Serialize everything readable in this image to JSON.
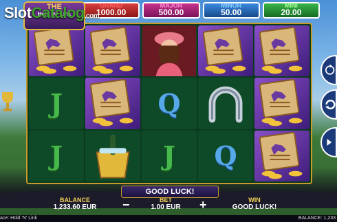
{
  "watermark": {
    "pre": "Slot",
    "accent": "Catalog",
    "tld": ".com"
  },
  "logo": {
    "title": "THE",
    "subtitle": "Hold 'N' Link"
  },
  "jackpots": [
    {
      "label": "GRAND",
      "value": "1000.00"
    },
    {
      "label": "MAJOR",
      "value": "500.00"
    },
    {
      "label": "MINOR",
      "value": "50.00"
    },
    {
      "label": "MINI",
      "value": "20.00"
    }
  ],
  "reels": [
    [
      "bonus-horse-card",
      "bonus-horse-card",
      "lady-portrait",
      "bonus-horse-card",
      "bonus-horse-card"
    ],
    [
      "J",
      "bonus-horse-card",
      "Q",
      "horseshoe",
      "bonus-horse-card"
    ],
    [
      "J",
      "champagne-bucket",
      "J",
      "Q",
      "bonus-horse-card"
    ]
  ],
  "message": "GOOD LUCK!",
  "balance": {
    "label": "BALANCE",
    "value": "1,233.60 EUR"
  },
  "bet": {
    "label": "BET",
    "value": "1.00 EUR"
  },
  "win": {
    "label": "WIN",
    "value": "GOOD LUCK!"
  },
  "buttons": {
    "minus": "−",
    "plus": "+"
  },
  "footer": {
    "left": "ace: Hold 'N' Link",
    "right": "BALANCE: 1,233"
  },
  "colors": {
    "frame": "#c89a2c",
    "reel_bg": "#0b3b1f",
    "bonus": "#8a4fc9"
  }
}
